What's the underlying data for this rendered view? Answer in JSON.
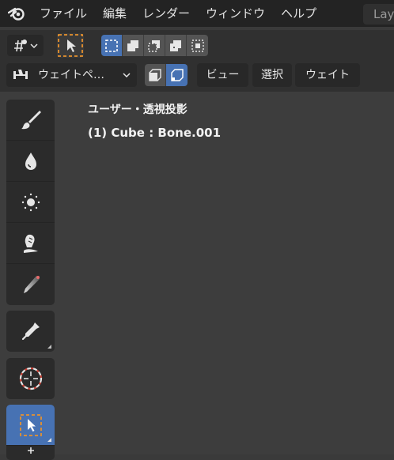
{
  "menubar": {
    "items": [
      "ファイル",
      "編集",
      "レンダー",
      "ウィンドウ",
      "ヘルプ"
    ],
    "workspace_tab": "Lay"
  },
  "header": {
    "mode_label": "ウェイトペ…",
    "menus": [
      "ビュー",
      "選択",
      "ウェイト"
    ]
  },
  "viewport": {
    "view_name": "ユーザー・透視投影",
    "object_info": "(1) Cube : Bone.001"
  },
  "colors": {
    "accent": "#4772b3",
    "select_box": "#e8922e"
  }
}
